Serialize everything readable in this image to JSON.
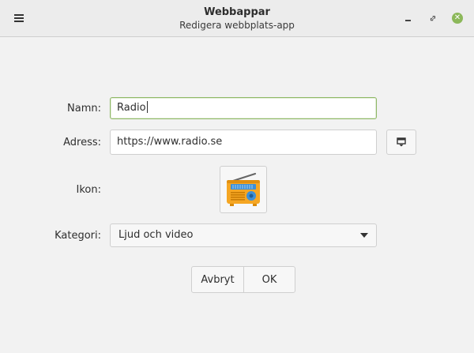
{
  "header": {
    "title": "Webbappar",
    "subtitle": "Redigera webbplats-app",
    "menu_icon": "hamburger-menu-icon",
    "window_controls": [
      "minimize-icon",
      "maximize-icon",
      "close-icon"
    ]
  },
  "form": {
    "name_label": "Namn:",
    "name_value": "Radio",
    "address_label": "Adress:",
    "address_value": "https://www.radio.se",
    "favicon_button_icon": "favicon-download-icon",
    "icon_label": "Ikon:",
    "icon_name": "radio-icon",
    "category_label": "Kategori:",
    "category_value": "Ljud och video"
  },
  "actions": {
    "cancel_label": "Avbryt",
    "ok_label": "OK"
  },
  "colors": {
    "focus_border": "#8fb866",
    "close_button": "#8cb85a",
    "radio_body": "#f5a623",
    "radio_dial": "#3d8fd6"
  }
}
